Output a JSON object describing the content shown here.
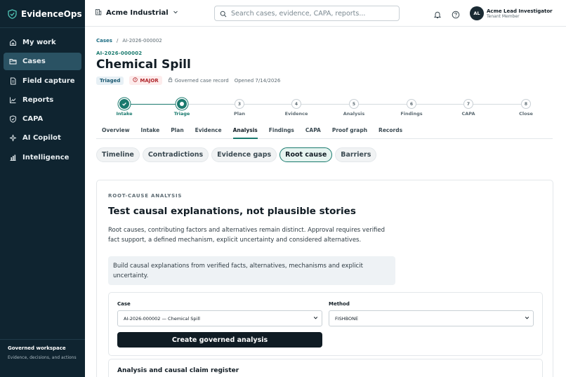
{
  "brand": {
    "name": "EvidenceOps"
  },
  "sidebar": {
    "items": [
      {
        "label": "My work",
        "icon": "home-icon"
      },
      {
        "label": "Cases",
        "icon": "folder-icon",
        "active": true
      },
      {
        "label": "Field capture",
        "icon": "file-icon"
      },
      {
        "label": "Reports",
        "icon": "chart-icon"
      },
      {
        "label": "CAPA",
        "icon": "shield-check-icon"
      },
      {
        "label": "AI Copilot",
        "icon": "sparkle-icon"
      },
      {
        "label": "Intelligence",
        "icon": "bar-chart-icon"
      }
    ],
    "footer": {
      "title": "Governed workspace",
      "subtitle": "Evidence, decisions, and actions"
    }
  },
  "topbar": {
    "tenant": "Acme Industrial",
    "search_placeholder": "Search cases, evidence, CAPA, reports...",
    "user": {
      "initials": "AL",
      "name": "Acme Lead Investigator",
      "role": "Tenant Member"
    }
  },
  "breadcrumb": {
    "root": "Cases",
    "separator": "/",
    "current": "AI-2026-000002"
  },
  "case": {
    "id": "AI-2026-000002",
    "title": "Chemical Spill",
    "status": "Triaged",
    "severity": "MAJOR",
    "record_type": "Governed case record",
    "opened": "Opened 7/14/2026"
  },
  "stepper": [
    {
      "label": "Intake",
      "state": "done",
      "num": "1"
    },
    {
      "label": "Triage",
      "state": "current",
      "num": "2"
    },
    {
      "label": "Plan",
      "state": "todo",
      "num": "3"
    },
    {
      "label": "Evidence",
      "state": "todo",
      "num": "4"
    },
    {
      "label": "Analysis",
      "state": "todo",
      "num": "5"
    },
    {
      "label": "Findings",
      "state": "todo",
      "num": "6"
    },
    {
      "label": "CAPA",
      "state": "todo",
      "num": "7"
    },
    {
      "label": "Close",
      "state": "todo",
      "num": "8"
    }
  ],
  "tabs": [
    "Overview",
    "Intake",
    "Plan",
    "Evidence",
    "Analysis",
    "Findings",
    "CAPA",
    "Proof graph",
    "Records"
  ],
  "active_tab": "Analysis",
  "subtabs": [
    "Timeline",
    "Contradictions",
    "Evidence gaps",
    "Root cause",
    "Barriers"
  ],
  "active_subtab": "Root cause",
  "panel": {
    "eyebrow": "ROOT-CAUSE ANALYSIS",
    "title": "Test causal explanations, not plausible stories",
    "description": "Root causes, contributing factors and alternatives remain distinct. Approval requires verified fact support, a defined mechanism, explicit uncertainty and considered alternatives.",
    "info": "Build causal explanations from verified facts, alternatives, mechanisms and explicit uncertainty.",
    "form": {
      "case_label": "Case",
      "case_value": "AI-2026-000002 — Chemical Spill",
      "method_label": "Method",
      "method_value": "FISHBONE",
      "submit_label": "Create governed analysis"
    },
    "register_title": "Analysis and causal claim register"
  }
}
